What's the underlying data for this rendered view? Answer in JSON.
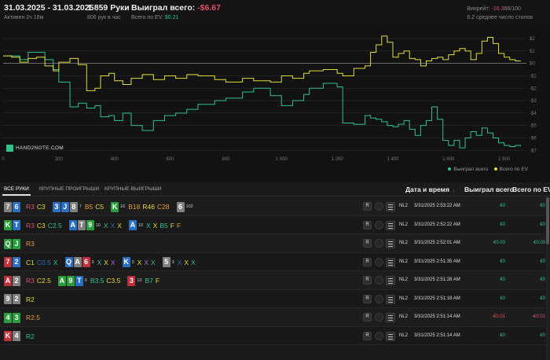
{
  "header": {
    "date_range": "31.03.2025 - 31.03.2025",
    "active": "Активен 2ч 18м",
    "hands": "1 859 Руки",
    "hands_per_hour": "806 рук в час",
    "won_label": "Выиграл всего:",
    "won_value": "-$6.67",
    "ev_label": "Всего по EV:",
    "ev_value": "$0.21",
    "winrate_label": "Винрейт:",
    "winrate_value": "-16.3",
    "winrate_suffix": "66/100",
    "tables": "8.2 среднее число столов"
  },
  "colors": {
    "won_line": "#2fc38a",
    "ev_line": "#e2dc3c",
    "negative": "#e0506c",
    "positive": "#2fc38a"
  },
  "chart_data": {
    "type": "line",
    "x": [
      0,
      30,
      60,
      90,
      120,
      150,
      180,
      200,
      240,
      270,
      300,
      330,
      350,
      380,
      400,
      430,
      460,
      500,
      540,
      580,
      620,
      660,
      700,
      760,
      800,
      860,
      900,
      960,
      1000,
      1040,
      1080,
      1100,
      1150,
      1200,
      1220,
      1260,
      1300,
      1320,
      1340,
      1360,
      1380,
      1400,
      1420,
      1440,
      1460,
      1480,
      1500,
      1520,
      1540,
      1560,
      1580,
      1600,
      1620,
      1640,
      1660,
      1680,
      1700,
      1720,
      1740,
      1760,
      1780,
      1800,
      1820,
      1840,
      1859
    ],
    "series": [
      {
        "name": "Выиграл всего",
        "values": [
          0.6,
          0.6,
          0.3,
          0.9,
          0.9,
          0.3,
          -0.5,
          -1.5,
          -3.5,
          -3.2,
          -3.6,
          -3.4,
          -4.3,
          -4.2,
          -4.6,
          -4.0,
          -5.0,
          -5.4,
          -4.6,
          -4.2,
          -4.0,
          -3.7,
          -3.3,
          -3.0,
          -2.8,
          -2.3,
          -2.0,
          -2.6,
          -3.4,
          -3.0,
          -2.5,
          -2.0,
          -1.6,
          -1.9,
          -4.8,
          -4.9,
          -4.2,
          -4.4,
          -4.5,
          -4.7,
          -5.0,
          -5.1,
          -4.9,
          -4.6,
          -5.3,
          -5.8,
          -5.0,
          -4.6,
          -3.5,
          -4.5,
          -6.2,
          -6.6,
          -6.2,
          -6.8,
          -6.0,
          -5.5,
          -5.8,
          -5.2,
          -5.6,
          -6.0,
          -6.4,
          -6.6,
          -6.7,
          -6.6,
          -6.67
        ]
      },
      {
        "name": "Всего по EV",
        "values": [
          0.6,
          0.5,
          0.1,
          0.4,
          0.5,
          -0.2,
          -0.6,
          0.1,
          0.4,
          -0.1,
          -2.2,
          -2.0,
          -1.0,
          -0.8,
          -1.4,
          -1.7,
          -1.2,
          -0.9,
          -1.3,
          -1.0,
          -1.2,
          -0.9,
          -1.0,
          -1.3,
          -1.5,
          -1.2,
          -1.4,
          -1.5,
          -1.0,
          -1.2,
          -0.8,
          -0.6,
          -0.5,
          -0.8,
          -1.0,
          -0.4,
          -0.2,
          0.9,
          1.5,
          2.2,
          1.7,
          0.5,
          0.8,
          1.0,
          0.4,
          0.3,
          -0.2,
          0.2,
          0.4,
          0.5,
          0.3,
          0.7,
          1.0,
          1.2,
          1.0,
          0.3,
          0.8,
          1.8,
          2.1,
          1.6,
          0.8,
          0.5,
          0.3,
          0.2,
          0.21
        ]
      }
    ],
    "x_ticks": [
      "0",
      "200",
      "400",
      "600",
      "800",
      "1 000",
      "1 200",
      "1 400",
      "1 600",
      "1 800"
    ],
    "y_ticks": [
      "$2",
      "$1",
      "$0",
      "-$1",
      "-$2",
      "-$3",
      "-$4",
      "-$5",
      "-$6",
      "-$7"
    ],
    "ylim": [
      -7.3,
      2.7
    ],
    "xlim": [
      0,
      1880
    ],
    "grid": true,
    "legend_position": "bottom-right"
  },
  "logo": {
    "brand": "HAND2NOTE.COM"
  },
  "tabs": [
    {
      "label": "ВСЕ РУКИ"
    },
    {
      "label": "КРУПНЫЕ ПРОИГРЫШИ"
    },
    {
      "label": "КРУПНЫЕ ВЫИГРЫШИ"
    }
  ],
  "columns": {
    "date": "Дата и время",
    "date_sort": "↓",
    "won": "Выиграл всего",
    "ev": "Всего по EV"
  },
  "row_controls": {
    "replay": "R",
    "stake": "NL2"
  },
  "rows": [
    {
      "date": "3/31/2025 2:53:22 AM",
      "won": "€0",
      "ev": "€0",
      "won_cls": "pos",
      "ev_cls": "pos"
    },
    {
      "date": "3/31/2025 2:52:22 AM",
      "won": "€0",
      "ev": "€0",
      "won_cls": "pos",
      "ev_cls": "pos"
    },
    {
      "date": "3/31/2025 2:52:01 AM",
      "won": "€0.03",
      "ev": "€0.03",
      "won_cls": "pos",
      "ev_cls": "pos"
    },
    {
      "date": "3/31/2025 2:51:35 AM",
      "won": "€0",
      "ev": "€0",
      "won_cls": "pos",
      "ev_cls": "pos"
    },
    {
      "date": "3/31/2025 2:51:28 AM",
      "won": "€0",
      "ev": "€0",
      "won_cls": "pos",
      "ev_cls": "pos"
    },
    {
      "date": "3/31/2025 2:51:18 AM",
      "won": "€0",
      "ev": "€0",
      "won_cls": "pos",
      "ev_cls": "pos"
    },
    {
      "date": "3/31/2025 2:51:14 AM",
      "won": "-€0.01",
      "ev": "-€0.01",
      "won_cls": "neg",
      "ev_cls": "neg"
    },
    {
      "date": "3/31/2025 2:51:14 AM",
      "won": "€0",
      "ev": "€0",
      "won_cls": "pos",
      "ev_cls": "pos"
    }
  ],
  "hand_lines": [
    [
      {
        "t": "card",
        "v": "7",
        "c": "#808080"
      },
      {
        "t": "card",
        "v": "6",
        "c": "#2b6fc0"
      },
      {
        "t": "gap"
      },
      {
        "t": "act",
        "v": "R3",
        "c": "#e0506c"
      },
      {
        "t": "act",
        "v": "C3",
        "c": "#e2dc3c"
      },
      {
        "t": "gap"
      },
      {
        "t": "card",
        "v": "3",
        "c": "#2b6fc0"
      },
      {
        "t": "card",
        "v": "J",
        "c": "#2b6fc0"
      },
      {
        "t": "card",
        "v": "8",
        "c": "#808080"
      },
      {
        "t": "sm",
        "v": "7"
      },
      {
        "t": "act",
        "v": "B5",
        "c": "#e89a3c"
      },
      {
        "t": "act",
        "v": "C5",
        "c": "#e2dc3c"
      },
      {
        "t": "gap"
      },
      {
        "t": "card",
        "v": "K",
        "c": "#2a9d3c"
      },
      {
        "t": "sm",
        "v": "16"
      },
      {
        "t": "act",
        "v": "B18",
        "c": "#e89a3c"
      },
      {
        "t": "act",
        "v": "R46",
        "c": "#e2dc3c"
      },
      {
        "t": "act",
        "v": "C28",
        "c": "#e89a3c"
      },
      {
        "t": "gap"
      },
      {
        "t": "card",
        "v": "6",
        "c": "#808080"
      },
      {
        "t": "sm",
        "v": "102"
      }
    ],
    [
      {
        "t": "card",
        "v": "K",
        "c": "#2a9d3c"
      },
      {
        "t": "card",
        "v": "T",
        "c": "#2b6fc0"
      },
      {
        "t": "gap"
      },
      {
        "t": "act",
        "v": "R3",
        "c": "#e0506c"
      },
      {
        "t": "act",
        "v": "C3",
        "c": "#e2dc3c"
      },
      {
        "t": "act",
        "v": "C2.5",
        "c": "#2fc38a"
      },
      {
        "t": "gap"
      },
      {
        "t": "card",
        "v": "A",
        "c": "#2b6fc0"
      },
      {
        "t": "card",
        "v": "T",
        "c": "#808080"
      },
      {
        "t": "card",
        "v": "9",
        "c": "#2a9d3c"
      },
      {
        "t": "sm",
        "v": "10"
      },
      {
        "t": "act",
        "v": "X",
        "c": "#2fc38a"
      },
      {
        "t": "act",
        "v": "X",
        "c": "#2b6fc0"
      },
      {
        "t": "act",
        "v": "X",
        "c": "#e2dc3c"
      },
      {
        "t": "gap"
      },
      {
        "t": "card",
        "v": "A",
        "c": "#2b6fc0"
      },
      {
        "t": "sm",
        "v": "10"
      },
      {
        "t": "act",
        "v": "X",
        "c": "#2fc38a"
      },
      {
        "t": "act",
        "v": "X",
        "c": "#e2dc3c"
      },
      {
        "t": "act",
        "v": "B5",
        "c": "#2fc38a"
      },
      {
        "t": "act",
        "v": "F",
        "c": "#e2dc3c"
      },
      {
        "t": "act",
        "v": "F",
        "c": "#e89a3c"
      }
    ],
    [
      {
        "t": "card",
        "v": "Q",
        "c": "#2a9d3c"
      },
      {
        "t": "card",
        "v": "J",
        "c": "#2a9d3c"
      },
      {
        "t": "gap"
      },
      {
        "t": "act",
        "v": "R3",
        "c": "#e89a3c"
      }
    ],
    [
      {
        "t": "card",
        "v": "7",
        "c": "#c0303c"
      },
      {
        "t": "card",
        "v": "2",
        "c": "#2b6fc0"
      },
      {
        "t": "gap"
      },
      {
        "t": "act",
        "v": "C1",
        "c": "#e2dc3c"
      },
      {
        "t": "act",
        "v": "C0.5",
        "c": "#2b6fc0"
      },
      {
        "t": "act",
        "v": "X",
        "c": "#2fc38a"
      },
      {
        "t": "gap"
      },
      {
        "t": "card",
        "v": "Q",
        "c": "#2b6fc0"
      },
      {
        "t": "card",
        "v": "A",
        "c": "#808080"
      },
      {
        "t": "card",
        "v": "6",
        "c": "#c0303c"
      },
      {
        "t": "sm",
        "v": "3"
      },
      {
        "t": "act",
        "v": "X",
        "c": "#2fc38a"
      },
      {
        "t": "act",
        "v": "X",
        "c": "#e2dc3c"
      },
      {
        "t": "act",
        "v": "X",
        "c": "#b06ad8"
      },
      {
        "t": "gap"
      },
      {
        "t": "card",
        "v": "K",
        "c": "#2b6fc0"
      },
      {
        "t": "sm",
        "v": "3"
      },
      {
        "t": "act",
        "v": "X",
        "c": "#e2dc3c"
      },
      {
        "t": "act",
        "v": "X",
        "c": "#b06ad8"
      },
      {
        "t": "act",
        "v": "X",
        "c": "#2fc38a"
      },
      {
        "t": "gap"
      },
      {
        "t": "card",
        "v": "5",
        "c": "#808080"
      },
      {
        "t": "sm",
        "v": "3"
      },
      {
        "t": "act",
        "v": "X",
        "c": "#2b6fc0"
      },
      {
        "t": "act",
        "v": "X",
        "c": "#e2dc3c"
      },
      {
        "t": "act",
        "v": "X",
        "c": "#2fc38a"
      }
    ],
    [
      {
        "t": "card",
        "v": "A",
        "c": "#c0303c"
      },
      {
        "t": "card",
        "v": "2",
        "c": "#808080"
      },
      {
        "t": "gap"
      },
      {
        "t": "act",
        "v": "R3",
        "c": "#e0506c"
      },
      {
        "t": "act",
        "v": "C2.5",
        "c": "#e2dc3c"
      },
      {
        "t": "gap"
      },
      {
        "t": "card",
        "v": "A",
        "c": "#2a9d3c"
      },
      {
        "t": "card",
        "v": "9",
        "c": "#2a9d3c"
      },
      {
        "t": "card",
        "v": "T",
        "c": "#2b6fc0"
      },
      {
        "t": "sm",
        "v": "6"
      },
      {
        "t": "act",
        "v": "B3.5",
        "c": "#2fc38a"
      },
      {
        "t": "act",
        "v": "C3.5",
        "c": "#e2dc3c"
      },
      {
        "t": "gap"
      },
      {
        "t": "card",
        "v": "3",
        "c": "#c0303c"
      },
      {
        "t": "sm",
        "v": "13"
      },
      {
        "t": "act",
        "v": "B7",
        "c": "#2fc38a"
      },
      {
        "t": "act",
        "v": "F",
        "c": "#e2dc3c"
      }
    ],
    [
      {
        "t": "card",
        "v": "9",
        "c": "#808080"
      },
      {
        "t": "card",
        "v": "2",
        "c": "#808080"
      },
      {
        "t": "gap"
      },
      {
        "t": "act",
        "v": "R2",
        "c": "#e2dc3c"
      }
    ],
    [
      {
        "t": "card",
        "v": "4",
        "c": "#2a9d3c"
      },
      {
        "t": "card",
        "v": "3",
        "c": "#2a9d3c"
      },
      {
        "t": "gap"
      },
      {
        "t": "act",
        "v": "R2.5",
        "c": "#e89a3c"
      }
    ],
    [
      {
        "t": "card",
        "v": "K",
        "c": "#c0303c"
      },
      {
        "t": "card",
        "v": "4",
        "c": "#808080"
      },
      {
        "t": "gap"
      },
      {
        "t": "act",
        "v": "R2",
        "c": "#2fc38a"
      }
    ]
  ]
}
